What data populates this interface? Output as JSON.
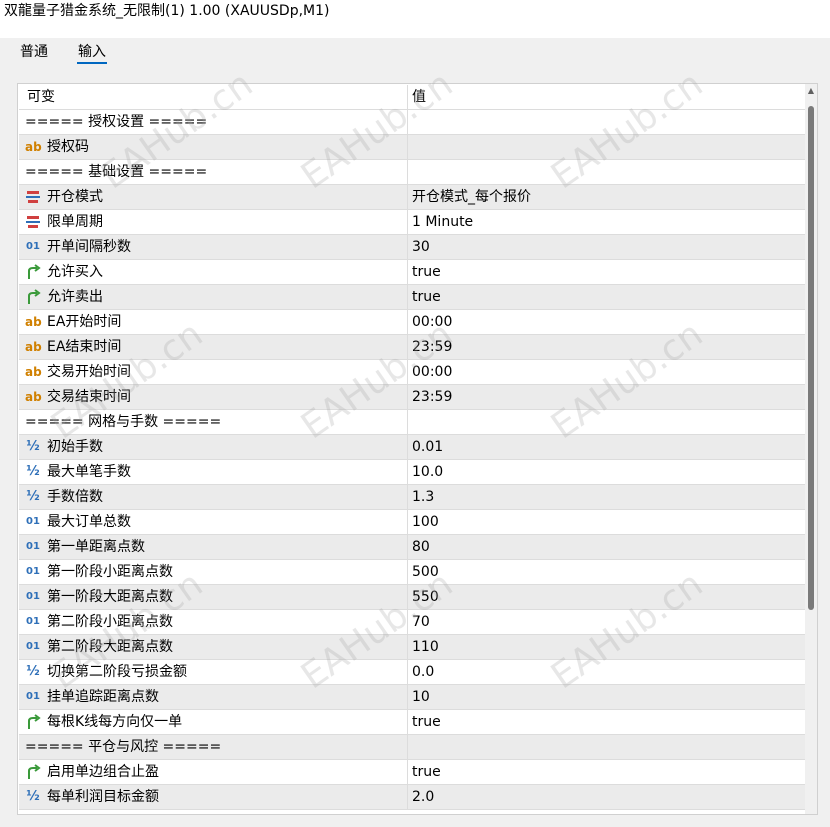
{
  "window": {
    "title": "双龍量子猎金系统_无限制(1) 1.00 (XAUUSDp,M1)"
  },
  "tabs": [
    {
      "label": "普通",
      "active": false
    },
    {
      "label": "输入",
      "active": true
    }
  ],
  "table": {
    "headers": {
      "variable": "可变",
      "value": "值"
    },
    "rows": [
      {
        "icon": "",
        "label": "===== 授权设置 =====",
        "value": ""
      },
      {
        "icon": "string-icon",
        "label": "授权码",
        "value": ""
      },
      {
        "icon": "",
        "label": "===== 基础设置 =====",
        "value": ""
      },
      {
        "icon": "enum-icon",
        "label": "开仓模式",
        "value": "开仓模式_每个报价"
      },
      {
        "icon": "enum-icon",
        "label": "限单周期",
        "value": "1 Minute"
      },
      {
        "icon": "integer-icon",
        "label": "开单间隔秒数",
        "value": "30"
      },
      {
        "icon": "bool-icon",
        "label": "允许买入",
        "value": "true"
      },
      {
        "icon": "bool-icon",
        "label": "允许卖出",
        "value": "true"
      },
      {
        "icon": "string-icon",
        "label": "EA开始时间",
        "value": "00:00"
      },
      {
        "icon": "string-icon",
        "label": "EA结束时间",
        "value": "23:59"
      },
      {
        "icon": "string-icon",
        "label": "交易开始时间",
        "value": "00:00"
      },
      {
        "icon": "string-icon",
        "label": "交易结束时间",
        "value": "23:59"
      },
      {
        "icon": "",
        "label": "===== 网格与手数 =====",
        "value": ""
      },
      {
        "icon": "double-icon",
        "label": "初始手数",
        "value": "0.01"
      },
      {
        "icon": "double-icon",
        "label": "最大单笔手数",
        "value": "10.0"
      },
      {
        "icon": "double-icon",
        "label": "手数倍数",
        "value": "1.3"
      },
      {
        "icon": "integer-icon",
        "label": "最大订单总数",
        "value": "100"
      },
      {
        "icon": "integer-icon",
        "label": "第一单距离点数",
        "value": "80"
      },
      {
        "icon": "integer-icon",
        "label": "第一阶段小距离点数",
        "value": "500"
      },
      {
        "icon": "integer-icon",
        "label": "第一阶段大距离点数",
        "value": "550"
      },
      {
        "icon": "integer-icon",
        "label": "第二阶段小距离点数",
        "value": "70"
      },
      {
        "icon": "integer-icon",
        "label": "第二阶段大距离点数",
        "value": "110"
      },
      {
        "icon": "double-icon",
        "label": "切换第二阶段亏损金额",
        "value": "0.0"
      },
      {
        "icon": "integer-icon",
        "label": "挂单追踪距离点数",
        "value": "10"
      },
      {
        "icon": "bool-icon",
        "label": "每根K线每方向仅一单",
        "value": "true"
      },
      {
        "icon": "",
        "label": "===== 平仓与风控 =====",
        "value": ""
      },
      {
        "icon": "bool-icon",
        "label": "启用单边组合止盈",
        "value": "true"
      },
      {
        "icon": "double-icon",
        "label": "每单利润目标金额",
        "value": "2.0"
      }
    ]
  },
  "watermark": {
    "text": "EAHub.cn"
  }
}
